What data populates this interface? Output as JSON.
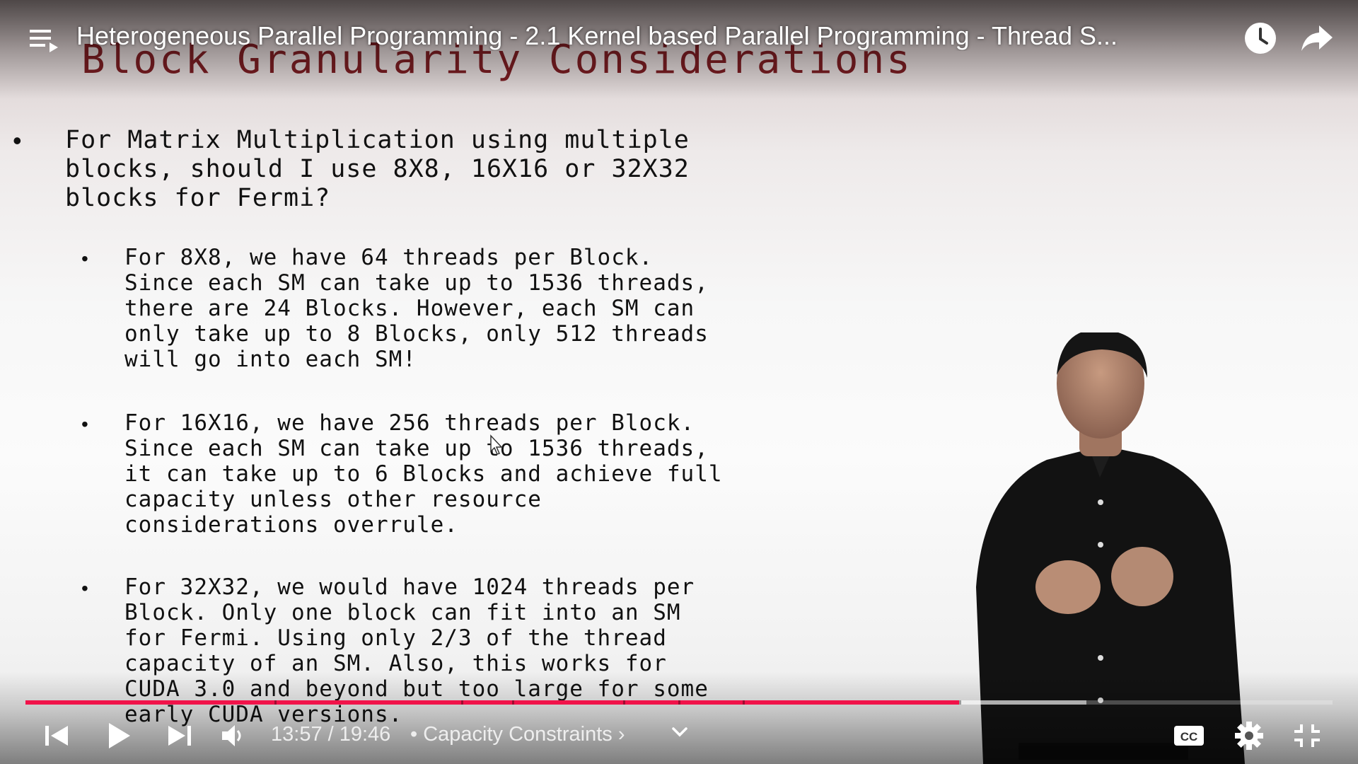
{
  "header": {
    "video_title": "Heterogeneous Parallel Programming - 2.1 Kernel based Parallel Programming - Thread S...",
    "playlist_icon": "playlist-icon",
    "watch_later_icon": "clock-icon",
    "share_icon": "share-arrow-icon"
  },
  "slide": {
    "title": "Block Granularity Considerations",
    "main_bullet": "•",
    "main_text": "For Matrix Multiplication using multiple\nblocks, should I use 8X8, 16X16 or 32X32\nblocks for Fermi?",
    "sub_bullet": "•",
    "subpoints": [
      "For 8X8, we have 64 threads per Block.\nSince each SM can take up to 1536 threads,\nthere are 24 Blocks. However, each SM can\nonly take up to 8 Blocks, only 512 threads\nwill go into each SM!",
      "For 16X16, we have 256 threads per Block.\nSince each SM can take up to 1536 threads,\nit can take up to 6 Blocks and achieve full\ncapacity unless other resource\nconsiderations overrule.",
      "For 32X32, we would have 1024 threads per\nBlock. Only one block can fit into an SM\nfor Fermi. Using only 2/3 of the thread\ncapacity of an SM. Also, this works for\nCUDA 3.0 and beyond but too large for some\nearly CUDA versions."
    ]
  },
  "player": {
    "progress": {
      "played_fraction": 0.7143,
      "buffered_fraction": 0.8115,
      "chapter_marks": [
        0.1905,
        0.3333,
        0.3725,
        0.4575,
        0.4995,
        0.5485,
        0.7143
      ],
      "played_color": "#f1134a"
    },
    "time_display": "13:57 / 19:46",
    "chapter_label": "• Capacity Constraints ›",
    "icons": {
      "prev": "skip-previous-icon",
      "play": "play-icon",
      "next": "skip-next-icon",
      "volume": "volume-icon",
      "chapter_toggle": "chevron-down-icon",
      "cc": "closed-captions-icon",
      "settings": "gear-icon",
      "fullscreen": "exit-fullscreen-icon"
    }
  }
}
